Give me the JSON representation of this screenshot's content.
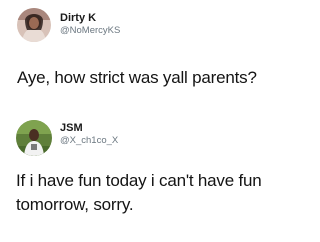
{
  "tweets": [
    {
      "display_name": "Dirty K",
      "handle": "@NoMercyKS",
      "avatar_icon": "profile-photo-icon",
      "text": "Aye, how strict was yall parents?"
    },
    {
      "display_name": "JSM",
      "handle": "@X_ch1co_X",
      "avatar_icon": "profile-photo-icon",
      "text_lines": [
        "If i have fun today i can't have fun",
        "tomorrow, sorry."
      ]
    }
  ],
  "colors": {
    "background": "#ffffff",
    "text": "#141414",
    "handle": "#6b7780"
  }
}
